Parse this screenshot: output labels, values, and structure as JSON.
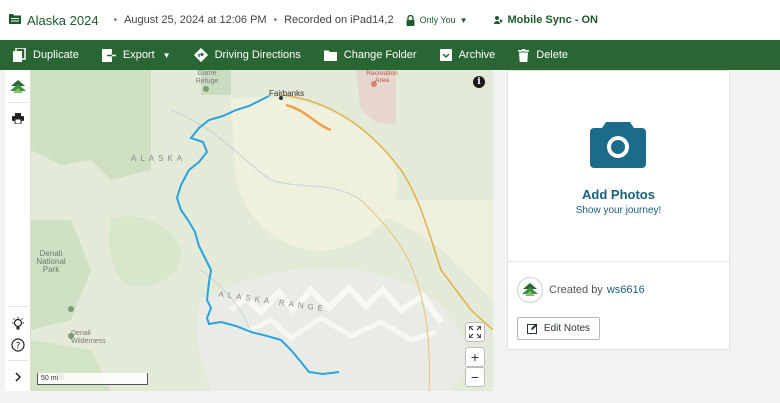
{
  "header": {
    "title": "Alaska 2024",
    "date": "August 25, 2024 at 12:06 PM",
    "recorded": "Recorded on iPad14,2",
    "privacy": "Only You",
    "sync": "Mobile Sync - ON"
  },
  "toolbar": {
    "duplicate": "Duplicate",
    "export": "Export",
    "directions": "Driving Directions",
    "change_folder": "Change Folder",
    "archive": "Archive",
    "delete": "Delete"
  },
  "map": {
    "labels": {
      "fairbanks": "Fairbanks",
      "alaska": "ALASKA",
      "alaska_range": "ALASKA RANGE",
      "denali_np": "Denali\nNational\nPark",
      "denali_wilderness": "Denali\nWilderness",
      "game_refuge": "Game\nRefuge",
      "recreation_area": "Recreation\nArea"
    },
    "scale": "50 mi",
    "zoom_in": "+",
    "zoom_out": "−"
  },
  "panel": {
    "add_photos": "Add Photos",
    "show_journey": "Show your journey!",
    "created_by": "Created by",
    "username": "ws6616",
    "edit_notes": "Edit Notes"
  },
  "colors": {
    "brand_green": "#2a6534",
    "link_blue": "#1c5f7a",
    "route": "#2aa3e0"
  }
}
